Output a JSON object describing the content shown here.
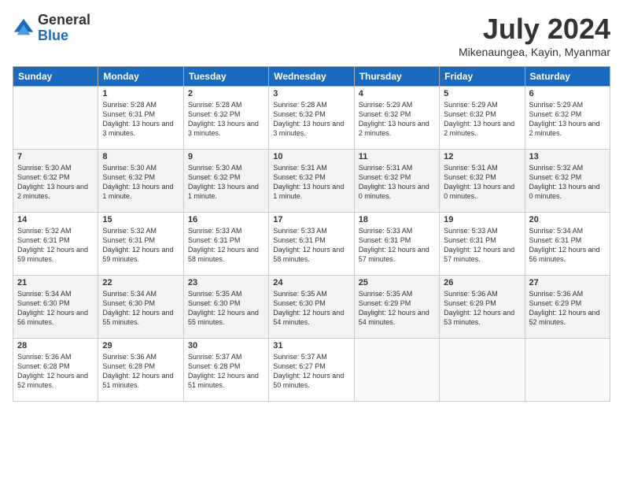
{
  "logo": {
    "general": "General",
    "blue": "Blue"
  },
  "title": "July 2024",
  "location": "Mikenaungea, Kayin, Myanmar",
  "headers": [
    "Sunday",
    "Monday",
    "Tuesday",
    "Wednesday",
    "Thursday",
    "Friday",
    "Saturday"
  ],
  "weeks": [
    [
      {
        "day": "",
        "sunrise": "",
        "sunset": "",
        "daylight": ""
      },
      {
        "day": "1",
        "sunrise": "Sunrise: 5:28 AM",
        "sunset": "Sunset: 6:31 PM",
        "daylight": "Daylight: 13 hours and 3 minutes."
      },
      {
        "day": "2",
        "sunrise": "Sunrise: 5:28 AM",
        "sunset": "Sunset: 6:32 PM",
        "daylight": "Daylight: 13 hours and 3 minutes."
      },
      {
        "day": "3",
        "sunrise": "Sunrise: 5:28 AM",
        "sunset": "Sunset: 6:32 PM",
        "daylight": "Daylight: 13 hours and 3 minutes."
      },
      {
        "day": "4",
        "sunrise": "Sunrise: 5:29 AM",
        "sunset": "Sunset: 6:32 PM",
        "daylight": "Daylight: 13 hours and 2 minutes."
      },
      {
        "day": "5",
        "sunrise": "Sunrise: 5:29 AM",
        "sunset": "Sunset: 6:32 PM",
        "daylight": "Daylight: 13 hours and 2 minutes."
      },
      {
        "day": "6",
        "sunrise": "Sunrise: 5:29 AM",
        "sunset": "Sunset: 6:32 PM",
        "daylight": "Daylight: 13 hours and 2 minutes."
      }
    ],
    [
      {
        "day": "7",
        "sunrise": "Sunrise: 5:30 AM",
        "sunset": "Sunset: 6:32 PM",
        "daylight": "Daylight: 13 hours and 2 minutes."
      },
      {
        "day": "8",
        "sunrise": "Sunrise: 5:30 AM",
        "sunset": "Sunset: 6:32 PM",
        "daylight": "Daylight: 13 hours and 1 minute."
      },
      {
        "day": "9",
        "sunrise": "Sunrise: 5:30 AM",
        "sunset": "Sunset: 6:32 PM",
        "daylight": "Daylight: 13 hours and 1 minute."
      },
      {
        "day": "10",
        "sunrise": "Sunrise: 5:31 AM",
        "sunset": "Sunset: 6:32 PM",
        "daylight": "Daylight: 13 hours and 1 minute."
      },
      {
        "day": "11",
        "sunrise": "Sunrise: 5:31 AM",
        "sunset": "Sunset: 6:32 PM",
        "daylight": "Daylight: 13 hours and 0 minutes."
      },
      {
        "day": "12",
        "sunrise": "Sunrise: 5:31 AM",
        "sunset": "Sunset: 6:32 PM",
        "daylight": "Daylight: 13 hours and 0 minutes."
      },
      {
        "day": "13",
        "sunrise": "Sunrise: 5:32 AM",
        "sunset": "Sunset: 6:32 PM",
        "daylight": "Daylight: 13 hours and 0 minutes."
      }
    ],
    [
      {
        "day": "14",
        "sunrise": "Sunrise: 5:32 AM",
        "sunset": "Sunset: 6:31 PM",
        "daylight": "Daylight: 12 hours and 59 minutes."
      },
      {
        "day": "15",
        "sunrise": "Sunrise: 5:32 AM",
        "sunset": "Sunset: 6:31 PM",
        "daylight": "Daylight: 12 hours and 59 minutes."
      },
      {
        "day": "16",
        "sunrise": "Sunrise: 5:33 AM",
        "sunset": "Sunset: 6:31 PM",
        "daylight": "Daylight: 12 hours and 58 minutes."
      },
      {
        "day": "17",
        "sunrise": "Sunrise: 5:33 AM",
        "sunset": "Sunset: 6:31 PM",
        "daylight": "Daylight: 12 hours and 58 minutes."
      },
      {
        "day": "18",
        "sunrise": "Sunrise: 5:33 AM",
        "sunset": "Sunset: 6:31 PM",
        "daylight": "Daylight: 12 hours and 57 minutes."
      },
      {
        "day": "19",
        "sunrise": "Sunrise: 5:33 AM",
        "sunset": "Sunset: 6:31 PM",
        "daylight": "Daylight: 12 hours and 57 minutes."
      },
      {
        "day": "20",
        "sunrise": "Sunrise: 5:34 AM",
        "sunset": "Sunset: 6:31 PM",
        "daylight": "Daylight: 12 hours and 56 minutes."
      }
    ],
    [
      {
        "day": "21",
        "sunrise": "Sunrise: 5:34 AM",
        "sunset": "Sunset: 6:30 PM",
        "daylight": "Daylight: 12 hours and 56 minutes."
      },
      {
        "day": "22",
        "sunrise": "Sunrise: 5:34 AM",
        "sunset": "Sunset: 6:30 PM",
        "daylight": "Daylight: 12 hours and 55 minutes."
      },
      {
        "day": "23",
        "sunrise": "Sunrise: 5:35 AM",
        "sunset": "Sunset: 6:30 PM",
        "daylight": "Daylight: 12 hours and 55 minutes."
      },
      {
        "day": "24",
        "sunrise": "Sunrise: 5:35 AM",
        "sunset": "Sunset: 6:30 PM",
        "daylight": "Daylight: 12 hours and 54 minutes."
      },
      {
        "day": "25",
        "sunrise": "Sunrise: 5:35 AM",
        "sunset": "Sunset: 6:29 PM",
        "daylight": "Daylight: 12 hours and 54 minutes."
      },
      {
        "day": "26",
        "sunrise": "Sunrise: 5:36 AM",
        "sunset": "Sunset: 6:29 PM",
        "daylight": "Daylight: 12 hours and 53 minutes."
      },
      {
        "day": "27",
        "sunrise": "Sunrise: 5:36 AM",
        "sunset": "Sunset: 6:29 PM",
        "daylight": "Daylight: 12 hours and 52 minutes."
      }
    ],
    [
      {
        "day": "28",
        "sunrise": "Sunrise: 5:36 AM",
        "sunset": "Sunset: 6:28 PM",
        "daylight": "Daylight: 12 hours and 52 minutes."
      },
      {
        "day": "29",
        "sunrise": "Sunrise: 5:36 AM",
        "sunset": "Sunset: 6:28 PM",
        "daylight": "Daylight: 12 hours and 51 minutes."
      },
      {
        "day": "30",
        "sunrise": "Sunrise: 5:37 AM",
        "sunset": "Sunset: 6:28 PM",
        "daylight": "Daylight: 12 hours and 51 minutes."
      },
      {
        "day": "31",
        "sunrise": "Sunrise: 5:37 AM",
        "sunset": "Sunset: 6:27 PM",
        "daylight": "Daylight: 12 hours and 50 minutes."
      },
      {
        "day": "",
        "sunrise": "",
        "sunset": "",
        "daylight": ""
      },
      {
        "day": "",
        "sunrise": "",
        "sunset": "",
        "daylight": ""
      },
      {
        "day": "",
        "sunrise": "",
        "sunset": "",
        "daylight": ""
      }
    ]
  ]
}
